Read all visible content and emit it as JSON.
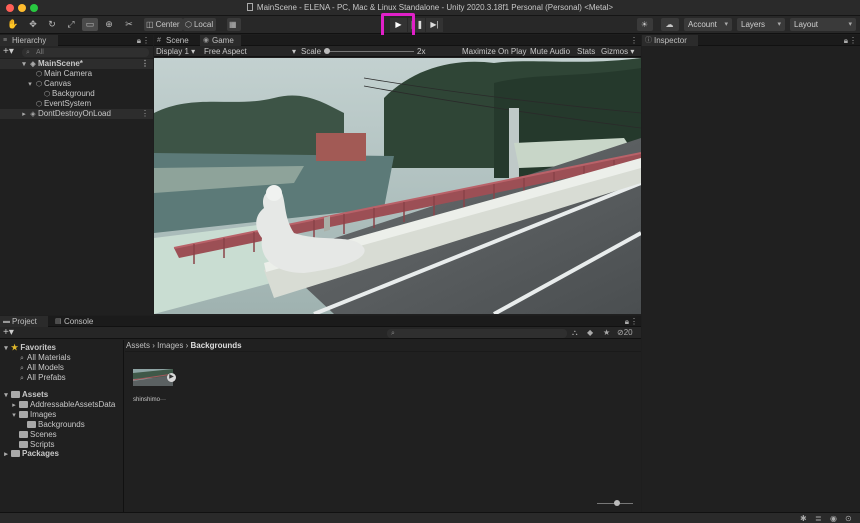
{
  "window": {
    "title": "MainScene - ELENA - PC, Mac & Linux Standalone - Unity 2020.3.18f1 Personal (Personal) <Metal>"
  },
  "toolbar": {
    "tools": [
      "hand-tool-icon",
      "move-tool-icon",
      "rotate-tool-icon",
      "scale-tool-icon",
      "rect-tool-icon",
      "transform-tool-icon",
      "custom-tool-icon"
    ],
    "pivot_label": "Center",
    "space_label": "Local",
    "play_icon": "play-icon",
    "pause_icon": "pause-icon",
    "step_icon": "step-icon",
    "account_label": "Account",
    "layers_label": "Layers",
    "layout_label": "Layout",
    "highlight_color": "#e020c8"
  },
  "hierarchy": {
    "tab_label": "Hierarchy",
    "search_placeholder": "All",
    "scene_name": "MainScene*",
    "items": [
      "Main Camera",
      "Canvas",
      "Background",
      "EventSystem"
    ],
    "ddol_name": "DontDestroyOnLoad"
  },
  "game": {
    "scene_tab_label": "Scene",
    "game_tab_label": "Game",
    "display_label": "Display 1",
    "aspect_label": "Free Aspect",
    "scale_label": "Scale",
    "scale_value": "2x",
    "maximize_label": "Maximize On Play",
    "mute_label": "Mute Audio",
    "stats_label": "Stats",
    "gizmos_label": "Gizmos"
  },
  "inspector": {
    "tab_label": "Inspector"
  },
  "project": {
    "project_tab_label": "Project",
    "console_tab_label": "Console",
    "favorites_label": "Favorites",
    "favorites": [
      "All Materials",
      "All Models",
      "All Prefabs"
    ],
    "assets_label": "Assets",
    "asset_folders": [
      "AddressableAssetsData",
      "Images",
      "Backgrounds",
      "Scenes",
      "Scripts"
    ],
    "packages_label": "Packages",
    "breadcrumb": [
      "Assets",
      "Images",
      "Backgrounds"
    ],
    "asset_item_label": "shinshimo···",
    "hidden_count": "20"
  }
}
